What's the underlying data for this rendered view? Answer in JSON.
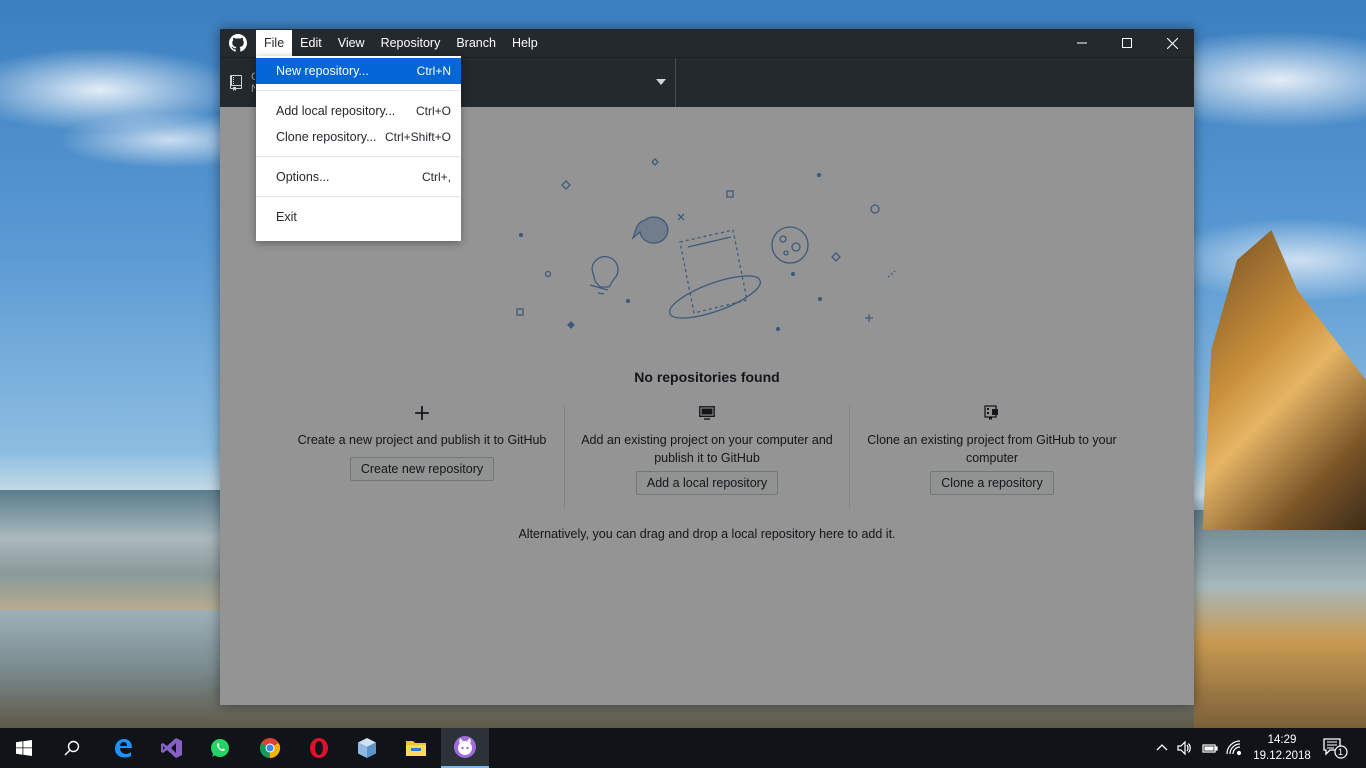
{
  "window": {
    "menu": [
      "File",
      "Edit",
      "View",
      "Repository",
      "Branch",
      "Help"
    ],
    "repo_fragment": "C N"
  },
  "file_menu": {
    "items": [
      {
        "label": "New repository...",
        "shortcut": "Ctrl+N"
      },
      {
        "label": "Add local repository...",
        "shortcut": "Ctrl+O"
      },
      {
        "label": "Clone repository...",
        "shortcut": "Ctrl+Shift+O"
      },
      {
        "label": "Options...",
        "shortcut": "Ctrl+,"
      },
      {
        "label": "Exit",
        "shortcut": ""
      }
    ]
  },
  "empty_state": {
    "title": "No repositories found",
    "actions": [
      {
        "icon": "plus-icon",
        "description": "Create a new project and publish it to GitHub",
        "button": "Create new repository"
      },
      {
        "icon": "desktop-icon",
        "description": "Add an existing project on your computer and publish it to GitHub",
        "button": "Add a local repository"
      },
      {
        "icon": "clone-repo-icon",
        "description": "Clone an existing project from GitHub to your computer",
        "button": "Clone a repository"
      }
    ],
    "drag_hint": "Alternatively, you can drag and drop a local repository here to add it."
  },
  "taskbar": {
    "apps": [
      "start-icon",
      "search-icon",
      "edge-icon",
      "visual-studio-icon",
      "whatsapp-icon",
      "chrome-icon",
      "opera-icon",
      "virtualbox-icon",
      "file-explorer-icon",
      "github-desktop-icon"
    ],
    "time": "14:29",
    "date": "19.12.2018",
    "notification_count": "1"
  },
  "colors": {
    "titlebar": "#24292e",
    "menu_highlight": "#0366d6",
    "taskbar": "#101418"
  }
}
